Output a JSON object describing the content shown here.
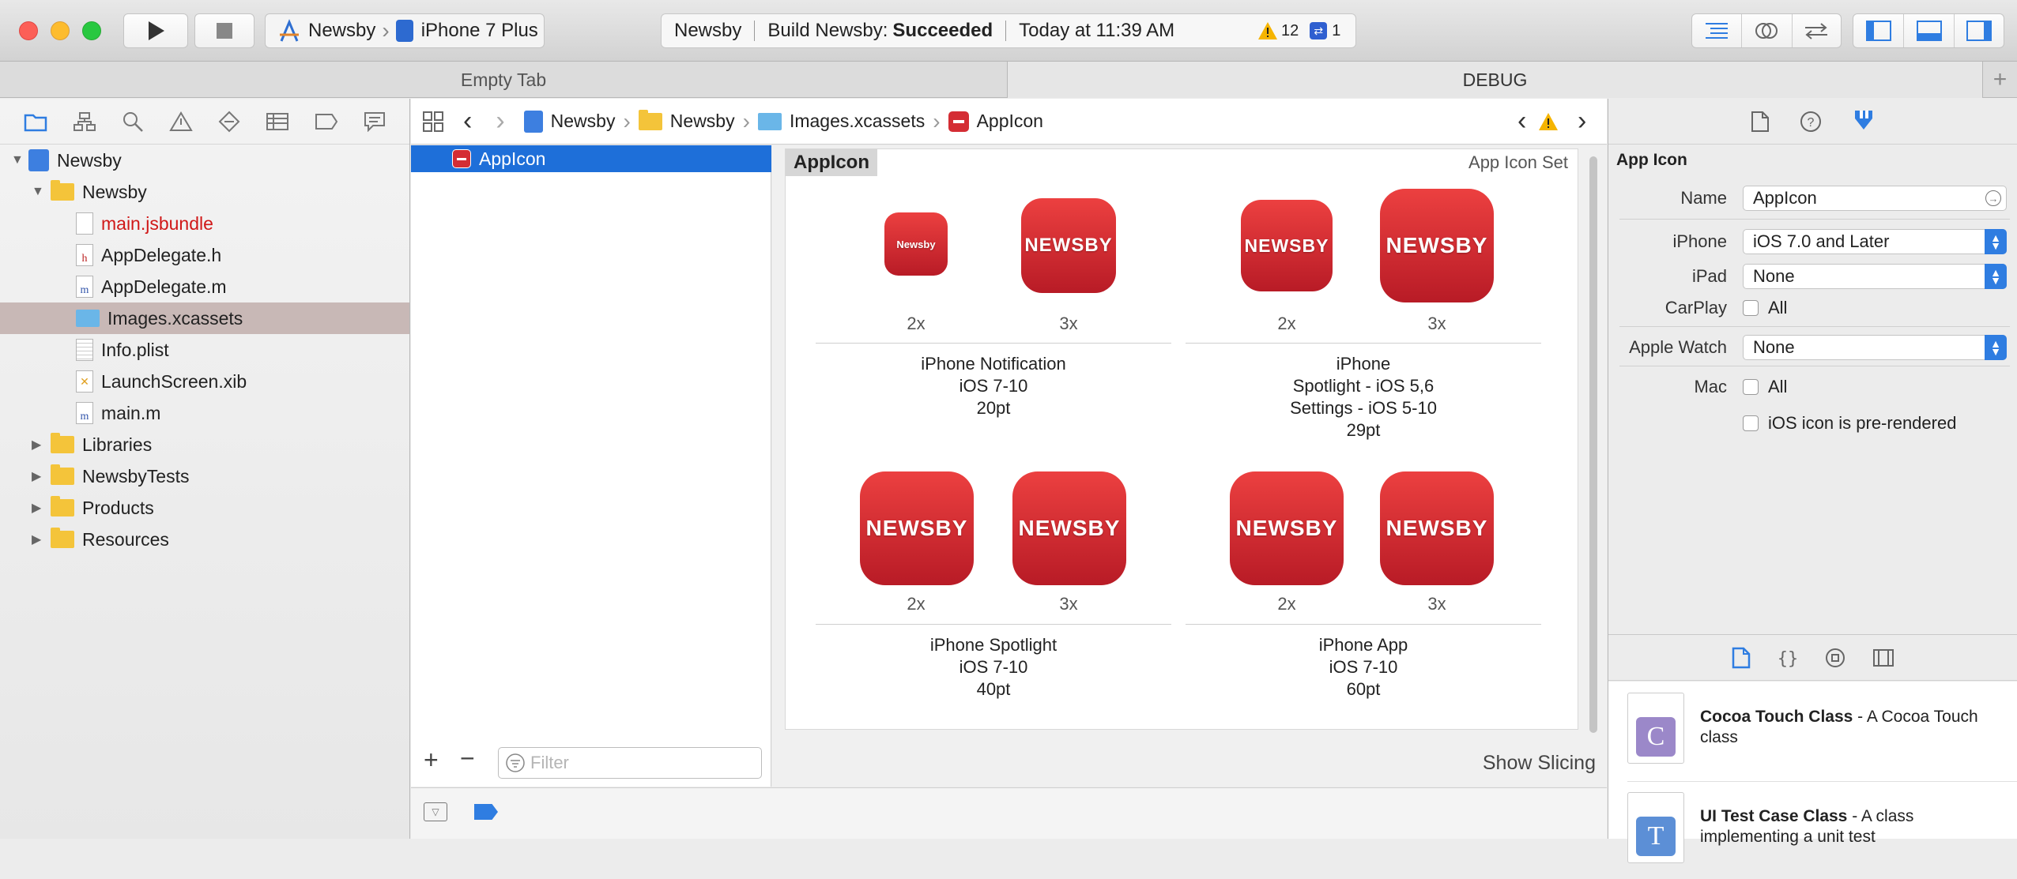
{
  "toolbar": {
    "scheme_name": "Newsby",
    "device_name": "iPhone 7 Plus",
    "status_project": "Newsby",
    "status_build": "Build Newsby:",
    "status_result": "Succeeded",
    "status_time": "Today at 11:39 AM",
    "warning_count": "12",
    "issue_count": "1"
  },
  "tabs": [
    {
      "label": "Empty Tab"
    },
    {
      "label": "DEBUG"
    }
  ],
  "navigator": {
    "items": [
      {
        "label": "Newsby"
      },
      {
        "label": "Newsby"
      },
      {
        "label": "main.jsbundle"
      },
      {
        "label": "AppDelegate.h",
        "glyph": "h"
      },
      {
        "label": "AppDelegate.m",
        "glyph": "m"
      },
      {
        "label": "Images.xcassets"
      },
      {
        "label": "Info.plist"
      },
      {
        "label": "LaunchScreen.xib"
      },
      {
        "label": "main.m",
        "glyph": "m"
      },
      {
        "label": "Libraries"
      },
      {
        "label": "NewsbyTests"
      },
      {
        "label": "Products"
      },
      {
        "label": "Resources"
      }
    ]
  },
  "jumpbar": {
    "crumbs": [
      "Newsby",
      "Newsby",
      "Images.xcassets",
      "AppIcon"
    ]
  },
  "assets": {
    "selected": "AppIcon",
    "filter_placeholder": "Filter"
  },
  "iconset": {
    "title": "AppIcon",
    "kind": "App Icon Set",
    "icon_text": "NEWSBY",
    "icon_text_small": "Newsby",
    "groups": [
      {
        "scales": [
          "2x",
          "3x"
        ],
        "lines": [
          "iPhone Notification",
          "iOS 7-10",
          "20pt"
        ]
      },
      {
        "scales": [
          "2x",
          "3x"
        ],
        "lines": [
          "iPhone",
          "Spotlight - iOS 5,6",
          "Settings - iOS 5-10",
          "29pt"
        ]
      },
      {
        "scales": [
          "2x",
          "3x"
        ],
        "lines": [
          "iPhone Spotlight",
          "iOS 7-10",
          "40pt"
        ]
      },
      {
        "scales": [
          "2x",
          "3x"
        ],
        "lines": [
          "iPhone App",
          "iOS 7-10",
          "60pt"
        ]
      }
    ],
    "show_slicing": "Show Slicing"
  },
  "inspector": {
    "section_title": "App Icon",
    "name_label": "Name",
    "name_value": "AppIcon",
    "iphone_label": "iPhone",
    "iphone_value": "iOS 7.0 and Later",
    "ipad_label": "iPad",
    "ipad_value": "None",
    "carplay_label": "CarPlay",
    "carplay_value": "All",
    "watch_label": "Apple Watch",
    "watch_value": "None",
    "mac_label": "Mac",
    "mac_value": "All",
    "prerendered_label": "iOS icon is pre-rendered"
  },
  "library": {
    "templates": [
      {
        "title": "Cocoa Touch Class",
        "desc": " - A Cocoa Touch class",
        "badge": "C",
        "color": "#9b88c9"
      },
      {
        "title": "UI Test Case Class",
        "desc": " - A class implementing a unit test",
        "badge": "T",
        "color": "#5c8fd6"
      }
    ]
  },
  "colors": {
    "accent": "#2f7de1",
    "selection": "#1e6fd9",
    "icon_red": "#d42d34",
    "modified_file": "#d01818"
  }
}
